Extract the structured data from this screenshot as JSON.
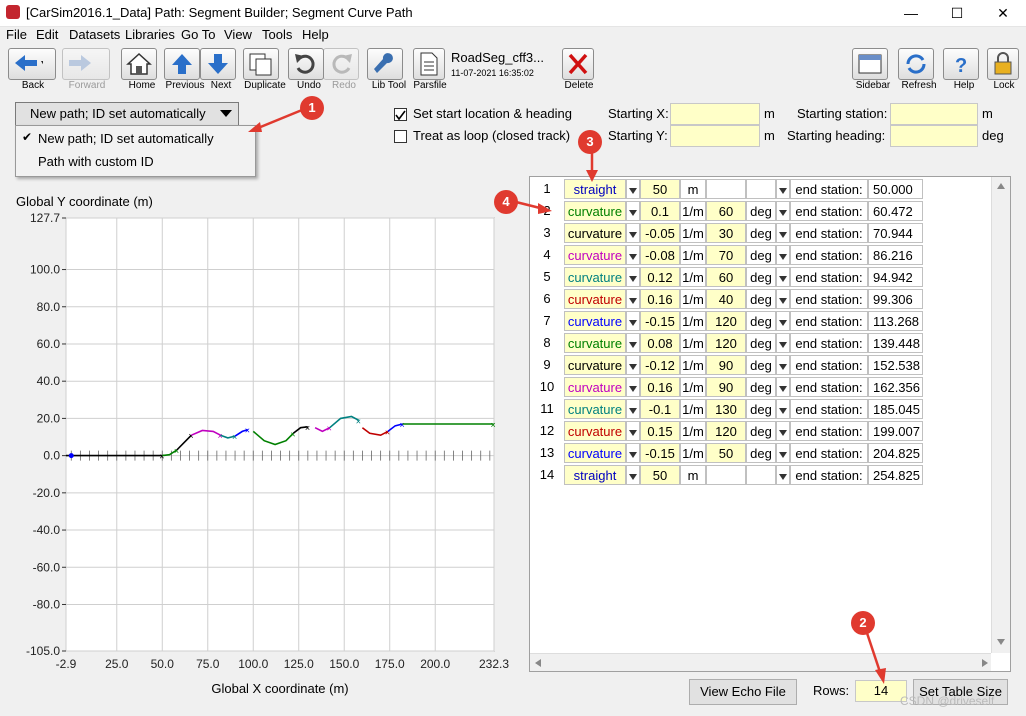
{
  "window": {
    "title": "[CarSim2016.1_Data] Path: Segment Builder; Segment  Curve Path",
    "minimize": "—",
    "maximize": "☐",
    "close": "✕"
  },
  "menu": [
    "File",
    "Edit",
    "Datasets",
    "Libraries",
    "Go To",
    "View",
    "Tools",
    "Help"
  ],
  "toolbar": {
    "back": "Back",
    "forward": "Forward",
    "home": "Home",
    "previous": "Previous",
    "next": "Next",
    "duplicate": "Duplicate",
    "undo": "Undo",
    "redo": "Redo",
    "libtool": "Lib Tool",
    "parsfile": "Parsfile",
    "dataset_name": "RoadSeg_cff3...",
    "dataset_date": "11-07-2021 16:35:02",
    "delete": "Delete",
    "sidebar": "Sidebar",
    "refresh": "Refresh",
    "help": "Help",
    "lock": "Lock"
  },
  "path_dropdown": {
    "selected": "New path; ID set automatically",
    "options": [
      "New path; ID set automatically",
      "Path with custom ID"
    ]
  },
  "options": {
    "start_loc": "Set start location & heading",
    "loop": "Treat as loop (closed track)"
  },
  "start_fields": {
    "x_label": "Starting X:",
    "y_label": "Starting Y:",
    "unit_m1": "m",
    "unit_m2": "m",
    "station_label": "Starting station:",
    "station_unit": "m",
    "heading_label": "Starting heading:",
    "heading_unit": "deg"
  },
  "badges": [
    "1",
    "2",
    "3",
    "4"
  ],
  "chart_data": {
    "type": "line",
    "ylabel": "Global Y coordinate (m)",
    "xlabel": "Global X coordinate (m)",
    "xlim": [
      -2.9,
      232.3
    ],
    "ylim": [
      -105.0,
      127.7
    ],
    "xticks": [
      "-2.9",
      "25.0",
      "50.0",
      "75.0",
      "100.0",
      "125.0",
      "150.0",
      "175.0",
      "200.0",
      "232.3"
    ],
    "yticks": [
      "127.7",
      "100.0",
      "80.0",
      "60.0",
      "40.0",
      "20.0",
      "0.0",
      "-20.0",
      "-40.0",
      "-60.0",
      "-80.0",
      "-105.0"
    ],
    "grid": true,
    "series": [
      {
        "color": "#000000",
        "points": [
          [
            -2.9,
            0
          ],
          [
            50,
            0
          ]
        ]
      },
      {
        "color": "#008000",
        "points": [
          [
            50,
            0
          ],
          [
            54,
            0.5
          ],
          [
            58,
            3
          ]
        ]
      },
      {
        "color": "#000000",
        "points": [
          [
            58,
            3
          ],
          [
            62,
            7
          ],
          [
            66,
            11
          ]
        ]
      },
      {
        "color": "#c000c0",
        "points": [
          [
            66,
            11
          ],
          [
            72,
            13.5
          ],
          [
            78,
            13
          ],
          [
            82,
            11
          ]
        ]
      },
      {
        "color": "#008080",
        "points": [
          [
            82,
            11
          ],
          [
            86,
            9.5
          ],
          [
            90,
            10.5
          ]
        ]
      },
      {
        "color": "#0000ff",
        "points": [
          [
            90,
            10.5
          ],
          [
            94,
            13
          ],
          [
            97,
            14
          ]
        ]
      },
      {
        "color": "#008000",
        "points": [
          [
            100,
            13
          ],
          [
            106,
            8
          ],
          [
            112,
            6
          ],
          [
            118,
            8
          ],
          [
            122,
            12
          ]
        ]
      },
      {
        "color": "#000000",
        "points": [
          [
            122,
            12
          ],
          [
            126,
            15
          ],
          [
            130,
            15.5
          ]
        ]
      },
      {
        "color": "#c000c0",
        "points": [
          [
            134,
            15
          ],
          [
            138,
            13
          ],
          [
            142,
            15
          ]
        ]
      },
      {
        "color": "#008080",
        "points": [
          [
            142,
            15
          ],
          [
            148,
            20
          ],
          [
            154,
            21
          ],
          [
            158,
            19
          ]
        ]
      },
      {
        "color": "#c00000",
        "points": [
          [
            160,
            15
          ],
          [
            164,
            12
          ],
          [
            170,
            11
          ],
          [
            174,
            13
          ]
        ]
      },
      {
        "color": "#0000ff",
        "points": [
          [
            174,
            13
          ],
          [
            178,
            16
          ],
          [
            182,
            17
          ]
        ]
      },
      {
        "color": "#008000",
        "points": [
          [
            182,
            17
          ],
          [
            232,
            17
          ]
        ]
      }
    ]
  },
  "table": {
    "rows": [
      {
        "n": "1",
        "type": "straight",
        "type_color": "#0000c0",
        "val": "50",
        "unit": "m",
        "ang": "",
        "ang_unit": "",
        "end": "end station:",
        "station": "50.000"
      },
      {
        "n": "2",
        "type": "curvature",
        "type_color": "#008000",
        "val": "0.1",
        "unit": "1/m",
        "ang": "60",
        "ang_unit": "deg",
        "end": "end station:",
        "station": "60.472"
      },
      {
        "n": "3",
        "type": "curvature",
        "type_color": "#000000",
        "val": "-0.05",
        "unit": "1/m",
        "ang": "30",
        "ang_unit": "deg",
        "end": "end station:",
        "station": "70.944"
      },
      {
        "n": "4",
        "type": "curvature",
        "type_color": "#c000c0",
        "val": "-0.08",
        "unit": "1/m",
        "ang": "70",
        "ang_unit": "deg",
        "end": "end station:",
        "station": "86.216"
      },
      {
        "n": "5",
        "type": "curvature",
        "type_color": "#008080",
        "val": "0.12",
        "unit": "1/m",
        "ang": "60",
        "ang_unit": "deg",
        "end": "end station:",
        "station": "94.942"
      },
      {
        "n": "6",
        "type": "curvature",
        "type_color": "#c00000",
        "val": "0.16",
        "unit": "1/m",
        "ang": "40",
        "ang_unit": "deg",
        "end": "end station:",
        "station": "99.306"
      },
      {
        "n": "7",
        "type": "curvature",
        "type_color": "#0000ff",
        "val": "-0.15",
        "unit": "1/m",
        "ang": "120",
        "ang_unit": "deg",
        "end": "end station:",
        "station": "113.268"
      },
      {
        "n": "8",
        "type": "curvature",
        "type_color": "#008000",
        "val": "0.08",
        "unit": "1/m",
        "ang": "120",
        "ang_unit": "deg",
        "end": "end station:",
        "station": "139.448"
      },
      {
        "n": "9",
        "type": "curvature",
        "type_color": "#000000",
        "val": "-0.12",
        "unit": "1/m",
        "ang": "90",
        "ang_unit": "deg",
        "end": "end station:",
        "station": "152.538"
      },
      {
        "n": "10",
        "type": "curvature",
        "type_color": "#c000c0",
        "val": "0.16",
        "unit": "1/m",
        "ang": "90",
        "ang_unit": "deg",
        "end": "end station:",
        "station": "162.356"
      },
      {
        "n": "11",
        "type": "curvature",
        "type_color": "#008080",
        "val": "-0.1",
        "unit": "1/m",
        "ang": "130",
        "ang_unit": "deg",
        "end": "end station:",
        "station": "185.045"
      },
      {
        "n": "12",
        "type": "curvature",
        "type_color": "#c00000",
        "val": "0.15",
        "unit": "1/m",
        "ang": "120",
        "ang_unit": "deg",
        "end": "end station:",
        "station": "199.007"
      },
      {
        "n": "13",
        "type": "curvature",
        "type_color": "#0000ff",
        "val": "-0.15",
        "unit": "1/m",
        "ang": "50",
        "ang_unit": "deg",
        "end": "end station:",
        "station": "204.825"
      },
      {
        "n": "14",
        "type": "straight",
        "type_color": "#0000c0",
        "val": "50",
        "unit": "m",
        "ang": "",
        "ang_unit": "",
        "end": "end station:",
        "station": "254.825"
      }
    ]
  },
  "bottom": {
    "echo_button": "View Echo File",
    "rows_label": "Rows:",
    "rows_value": "14",
    "set_size_button": "Set Table Size"
  },
  "watermark": "CSDN @driveself"
}
